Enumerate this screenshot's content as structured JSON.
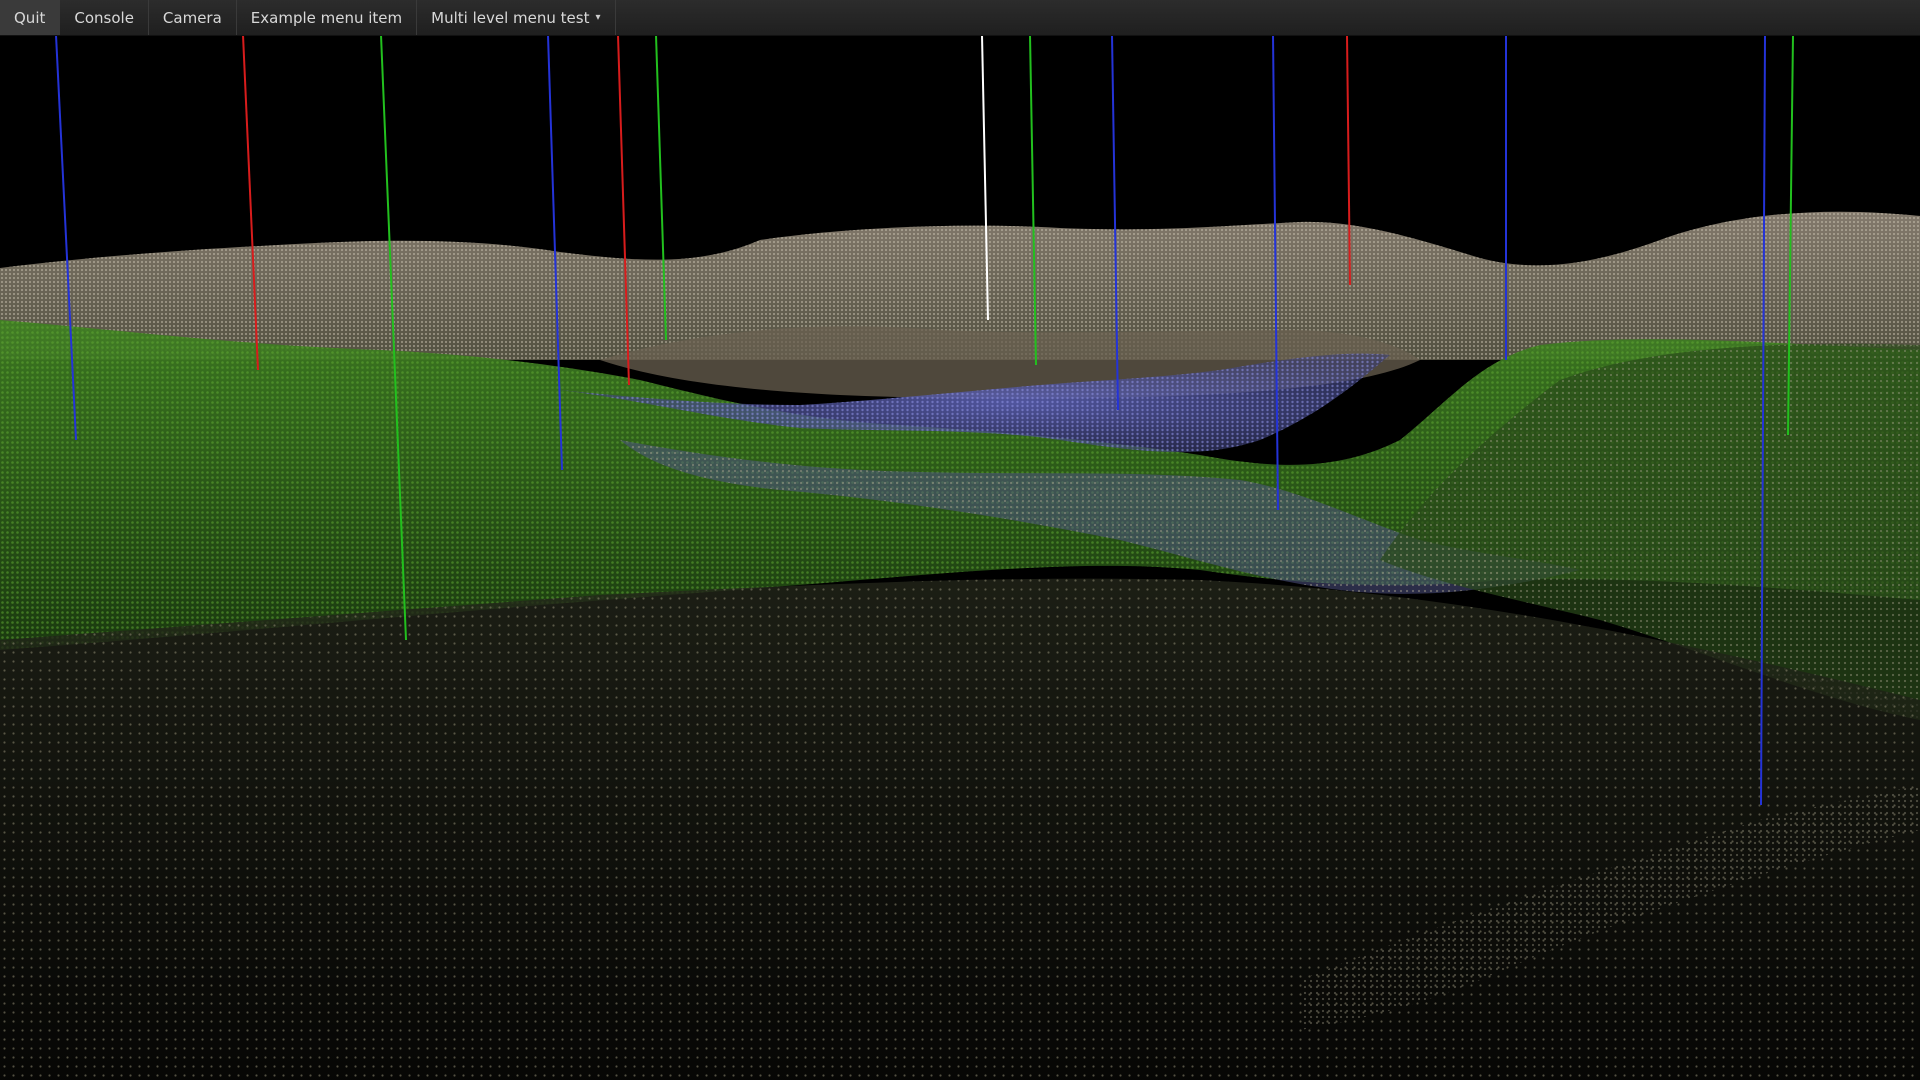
{
  "menubar": {
    "items": [
      {
        "label": "Quit"
      },
      {
        "label": "Console"
      },
      {
        "label": "Camera"
      },
      {
        "label": "Example menu item"
      },
      {
        "label": "Multi level menu test",
        "submenu": true
      }
    ],
    "caret": "▾"
  },
  "scene": {
    "background_color": "#000000",
    "markers": [
      {
        "color": "#2433d8"
      },
      {
        "color": "#d81c1c"
      },
      {
        "color": "#22c01e"
      },
      {
        "color": "#2433d8"
      },
      {
        "color": "#d81c1c"
      },
      {
        "color": "#22c01e"
      },
      {
        "color": "#ffffff"
      },
      {
        "color": "#22c01e"
      },
      {
        "color": "#2433d8"
      },
      {
        "color": "#2433d8"
      },
      {
        "color": "#d81c1c"
      },
      {
        "color": "#2433d8"
      },
      {
        "color": "#2433d8"
      },
      {
        "color": "#22c01e"
      }
    ]
  }
}
